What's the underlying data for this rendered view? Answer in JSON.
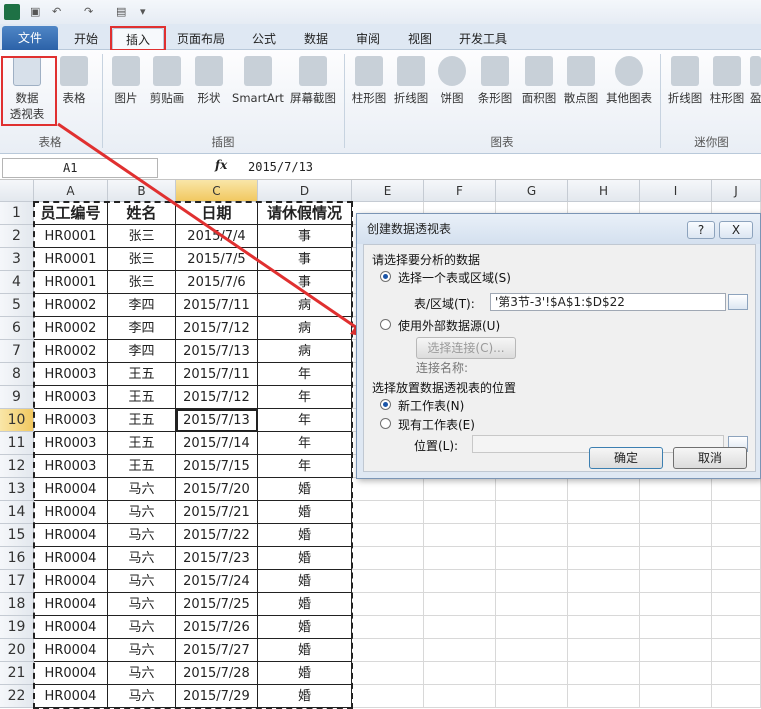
{
  "titlebar": {
    "undo_icon": "undo-icon",
    "redo_icon": "redo-icon",
    "customize": "▾"
  },
  "ribbon_tabs": [
    "文件",
    "开始",
    "插入",
    "页面布局",
    "公式",
    "数据",
    "审阅",
    "视图",
    "开发工具"
  ],
  "active_tab": "插入",
  "ribbon": {
    "pivot_label": "数据\n透视表",
    "pivot_line1": "数据",
    "pivot_line2": "透视表",
    "table_label": "表格",
    "picture": "图片",
    "clipart": "剪贴画",
    "shapes": "形状",
    "smartart": "SmartArt",
    "screenshot": "屏幕截图",
    "column_chart": "柱形图",
    "line_chart": "折线图",
    "pie_chart": "饼图",
    "bar_chart": "条形图",
    "area_chart": "面积图",
    "scatter_chart": "散点图",
    "other_chart": "其他图表",
    "spark_line": "折线图",
    "spark_column": "柱形图",
    "spark_winloss": "盈",
    "group_tables": "表格",
    "group_illustrations": "插图",
    "group_charts": "图表",
    "group_sparklines": "迷你图"
  },
  "formula_bar": {
    "name_box": "A1",
    "fx": "fx",
    "value": "2015/7/13"
  },
  "columns": [
    "A",
    "B",
    "C",
    "D",
    "E",
    "F",
    "G",
    "H",
    "I",
    "J"
  ],
  "sheet": {
    "headers": [
      "员工编号",
      "姓名",
      "日期",
      "请休假情况"
    ],
    "rows": [
      [
        "HR0001",
        "张三",
        "2015/7/4",
        "事"
      ],
      [
        "HR0001",
        "张三",
        "2015/7/5",
        "事"
      ],
      [
        "HR0001",
        "张三",
        "2015/7/6",
        "事"
      ],
      [
        "HR0002",
        "李四",
        "2015/7/11",
        "病"
      ],
      [
        "HR0002",
        "李四",
        "2015/7/12",
        "病"
      ],
      [
        "HR0002",
        "李四",
        "2015/7/13",
        "病"
      ],
      [
        "HR0003",
        "王五",
        "2015/7/11",
        "年"
      ],
      [
        "HR0003",
        "王五",
        "2015/7/12",
        "年"
      ],
      [
        "HR0003",
        "王五",
        "2015/7/13",
        "年"
      ],
      [
        "HR0003",
        "王五",
        "2015/7/14",
        "年"
      ],
      [
        "HR0003",
        "王五",
        "2015/7/15",
        "年"
      ],
      [
        "HR0004",
        "马六",
        "2015/7/20",
        "婚"
      ],
      [
        "HR0004",
        "马六",
        "2015/7/21",
        "婚"
      ],
      [
        "HR0004",
        "马六",
        "2015/7/22",
        "婚"
      ],
      [
        "HR0004",
        "马六",
        "2015/7/23",
        "婚"
      ],
      [
        "HR0004",
        "马六",
        "2015/7/24",
        "婚"
      ],
      [
        "HR0004",
        "马六",
        "2015/7/25",
        "婚"
      ],
      [
        "HR0004",
        "马六",
        "2015/7/26",
        "婚"
      ],
      [
        "HR0004",
        "马六",
        "2015/7/27",
        "婚"
      ],
      [
        "HR0004",
        "马六",
        "2015/7/28",
        "婚"
      ],
      [
        "HR0004",
        "马六",
        "2015/7/29",
        "婚"
      ]
    ]
  },
  "dialog": {
    "title": "创建数据透视表",
    "help": "?",
    "close": "X",
    "section1": "请选择要分析的数据",
    "opt_range": "选择一个表或区域(S)",
    "range_label": "表/区域(T):",
    "range_value": "'第3节-3'!$A$1:$D$22",
    "opt_external": "使用外部数据源(U)",
    "choose_conn": "选择连接(C)...",
    "conn_name": "连接名称:",
    "section2": "选择放置数据透视表的位置",
    "opt_new": "新工作表(N)",
    "opt_existing": "现有工作表(E)",
    "location_label": "位置(L):",
    "location_value": "",
    "ok": "确定",
    "cancel": "取消"
  },
  "colors": {
    "accent": "#2c62a8",
    "highlight": "#e03030",
    "file_tab": "#3a72b8"
  }
}
